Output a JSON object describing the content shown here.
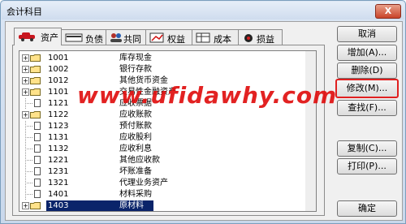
{
  "window": {
    "title": "会计科目",
    "close": "X"
  },
  "tabs": [
    {
      "label": "资产",
      "icon": "car-icon"
    },
    {
      "label": "负债",
      "icon": "card-icon"
    },
    {
      "label": "共同",
      "icon": "people-icon"
    },
    {
      "label": "权益",
      "icon": "chart-icon"
    },
    {
      "label": "成本",
      "icon": "table-icon"
    },
    {
      "label": "损益",
      "icon": "bag-icon"
    }
  ],
  "tree": [
    {
      "code": "1001",
      "name": "库存现金",
      "expandable": true,
      "folder": true
    },
    {
      "code": "1002",
      "name": "银行存款",
      "expandable": true,
      "folder": true
    },
    {
      "code": "1012",
      "name": "其他货币资金",
      "expandable": true,
      "folder": true
    },
    {
      "code": "1101",
      "name": "交易性金融资产",
      "expandable": true,
      "folder": true
    },
    {
      "code": "1121",
      "name": "应收票据",
      "expandable": false,
      "folder": false
    },
    {
      "code": "1122",
      "name": "应收账款",
      "expandable": true,
      "folder": true
    },
    {
      "code": "1123",
      "name": "预付账款",
      "expandable": false,
      "folder": false
    },
    {
      "code": "1131",
      "name": "应收股利",
      "expandable": false,
      "folder": false
    },
    {
      "code": "1132",
      "name": "应收利息",
      "expandable": false,
      "folder": false
    },
    {
      "code": "1221",
      "name": "其他应收款",
      "expandable": false,
      "folder": false
    },
    {
      "code": "1231",
      "name": "坏账准备",
      "expandable": false,
      "folder": false
    },
    {
      "code": "1321",
      "name": "代理业务资产",
      "expandable": false,
      "folder": false
    },
    {
      "code": "1401",
      "name": "材料采购",
      "expandable": false,
      "folder": false
    },
    {
      "code": "1403",
      "name": "原材料",
      "expandable": true,
      "folder": true,
      "selected": true
    }
  ],
  "buttons": {
    "cancel": "取消",
    "add": "增加(A)...",
    "delete": "删除(D)",
    "modify": "修改(M)...",
    "find": "查找(F)...",
    "copy": "复制(C)...",
    "print": "打印(P)...",
    "ok": "确定"
  },
  "watermark": "www.ufidawhy.com",
  "colors": {
    "selection": "#0a246a",
    "watermark": "#e01010",
    "focus_border": "#e02020"
  }
}
